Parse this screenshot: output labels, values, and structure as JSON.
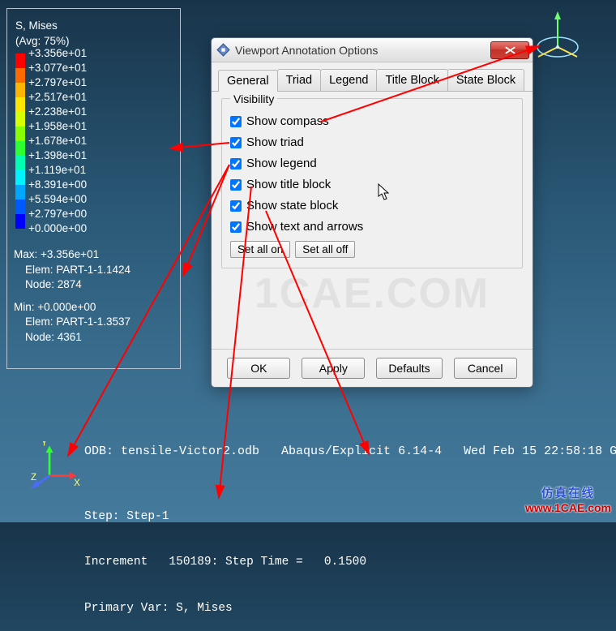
{
  "legend": {
    "title": "S, Mises",
    "avg": "(Avg: 75%)",
    "ticks": [
      "+3.356e+01",
      "+3.077e+01",
      "+2.797e+01",
      "+2.517e+01",
      "+2.238e+01",
      "+1.958e+01",
      "+1.678e+01",
      "+1.398e+01",
      "+1.119e+01",
      "+8.391e+00",
      "+5.594e+00",
      "+2.797e+00",
      "+0.000e+00"
    ],
    "colors": [
      "#ff0000",
      "#ff6a00",
      "#ffb400",
      "#ffe600",
      "#d6ff00",
      "#88ff00",
      "#2dff30",
      "#00ffb0",
      "#00f2ff",
      "#00a7ff",
      "#005bff",
      "#0000ff"
    ],
    "max_label": "Max: +3.356e+01",
    "max_elem": "Elem: PART-1-1.1424",
    "max_node": "Node: 2874",
    "min_label": "Min: +0.000e+00",
    "min_elem": "Elem: PART-1-1.3537",
    "min_node": "Node: 4361"
  },
  "triad": {
    "x": "X",
    "y": "Y",
    "z": "Z"
  },
  "title_block": {
    "odb_line": "ODB: tensile-Victor2.odb   Abaqus/Explicit 6.14-4   Wed Feb 15 22:58:18 G"
  },
  "state_block": {
    "line1": "Step: Step-1",
    "line2": "Increment   150189: Step Time =   0.1500",
    "line3": "Primary Var: S, Mises"
  },
  "dialog": {
    "title": "Viewport Annotation Options",
    "tabs": {
      "general": "General",
      "triad": "Triad",
      "legend": "Legend",
      "title_block": "Title Block",
      "state_block": "State Block"
    },
    "group_label": "Visibility",
    "checks": {
      "compass": "Show compass",
      "triad": "Show triad",
      "legend": "Show legend",
      "title_block": "Show title block",
      "state_block": "Show state block",
      "text_arrows": "Show text and arrows"
    },
    "set_all_on": "Set all on",
    "set_all_off": "Set all off",
    "ok": "OK",
    "apply": "Apply",
    "defaults": "Defaults",
    "cancel": "Cancel",
    "watermark": "1CAE.COM"
  },
  "watermark": {
    "cn": "仿真在线",
    "url": "www.1CAE.com"
  }
}
